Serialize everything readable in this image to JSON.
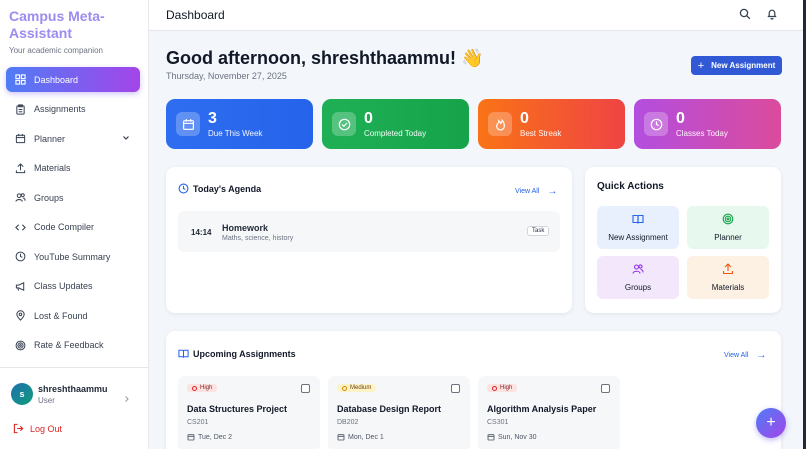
{
  "brand": {
    "title": "Campus Meta-Assistant",
    "subtitle": "Your academic companion"
  },
  "sidebar": {
    "items": [
      {
        "label": "Dashboard",
        "icon": "grid-icon",
        "active": true
      },
      {
        "label": "Assignments",
        "icon": "clipboard-icon"
      },
      {
        "label": "Planner",
        "icon": "calendar-icon",
        "expandable": true
      },
      {
        "label": "Materials",
        "icon": "upload-icon"
      },
      {
        "label": "Groups",
        "icon": "users-icon"
      },
      {
        "label": "Code Compiler",
        "icon": "code-icon"
      },
      {
        "label": "YouTube Summary",
        "icon": "clock-icon"
      },
      {
        "label": "Class Updates",
        "icon": "megaphone-icon"
      },
      {
        "label": "Lost & Found",
        "icon": "map-pin-icon"
      },
      {
        "label": "Rate & Feedback",
        "icon": "target-icon"
      }
    ],
    "user": {
      "initial": "s",
      "name": "shreshthaammu",
      "role": "User"
    },
    "logout_label": "Log Out"
  },
  "topbar": {
    "title": "Dashboard"
  },
  "header": {
    "greeting": "Good afternoon, shreshthaammu! 👋",
    "date": "Thursday, November 27, 2025",
    "new_assignment_label": "New Assignment"
  },
  "stats": [
    {
      "value": "3",
      "label": "Due This Week",
      "color": "#2f6df0"
    },
    {
      "value": "0",
      "label": "Completed Today",
      "color": "#16a34a"
    },
    {
      "value": "0",
      "label": "Best Streak",
      "color": "#f4511e"
    },
    {
      "value": "0",
      "label": "Classes Today",
      "color": "#c04bd0"
    }
  ],
  "agenda": {
    "title": "Today's Agenda",
    "view_all": "View All",
    "items": [
      {
        "time": "14:14",
        "title": "Homework",
        "subtitle": "Maths, science, history",
        "badge": "Task"
      }
    ]
  },
  "quick_actions": {
    "title": "Quick Actions",
    "items": [
      {
        "label": "New Assignment",
        "bg": "#e8f0fe",
        "color": "#2563eb"
      },
      {
        "label": "Planner",
        "bg": "#e7f8ee",
        "color": "#16a34a"
      },
      {
        "label": "Groups",
        "bg": "#f3e8fb",
        "color": "#9333ea"
      },
      {
        "label": "Materials",
        "bg": "#fdf1e4",
        "color": "#ea580c"
      }
    ]
  },
  "upcoming": {
    "title": "Upcoming Assignments",
    "view_all": "View All",
    "items": [
      {
        "priority": "High",
        "title": "Data Structures Project",
        "code": "CS201",
        "due": "Tue, Dec 2"
      },
      {
        "priority": "Medium",
        "title": "Database Design Report",
        "code": "DB202",
        "due": "Mon, Dec 1"
      },
      {
        "priority": "High",
        "title": "Algorithm Analysis Paper",
        "code": "CS301",
        "due": "Sun, Nov 30"
      }
    ]
  },
  "fab_label": "+"
}
